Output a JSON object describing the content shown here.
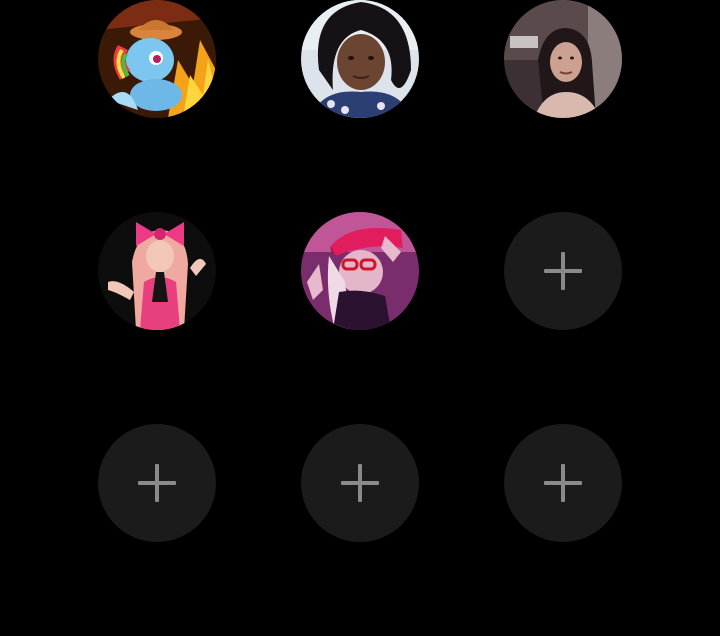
{
  "grid": {
    "avatars": [
      {
        "name": "avatar-cartoon-pony",
        "icon": "pony-avatar-image",
        "bg": "#f39a1e"
      },
      {
        "name": "avatar-girl-curly-hair",
        "icon": "portrait-avatar-image",
        "bg": "#dfe6ee"
      },
      {
        "name": "avatar-girl-dark-room",
        "icon": "portrait-avatar-image",
        "bg": "#4a3a3c"
      },
      {
        "name": "avatar-pink-bow",
        "icon": "portrait-avatar-image",
        "bg": "#111111"
      },
      {
        "name": "avatar-pink-cap",
        "icon": "portrait-avatar-image",
        "bg": "#8b2c7a"
      }
    ],
    "empty_slots": 4,
    "add_icon": "plus-icon",
    "add_slot_color": "#1b1b1b",
    "plus_color": "#8a8a8a"
  }
}
